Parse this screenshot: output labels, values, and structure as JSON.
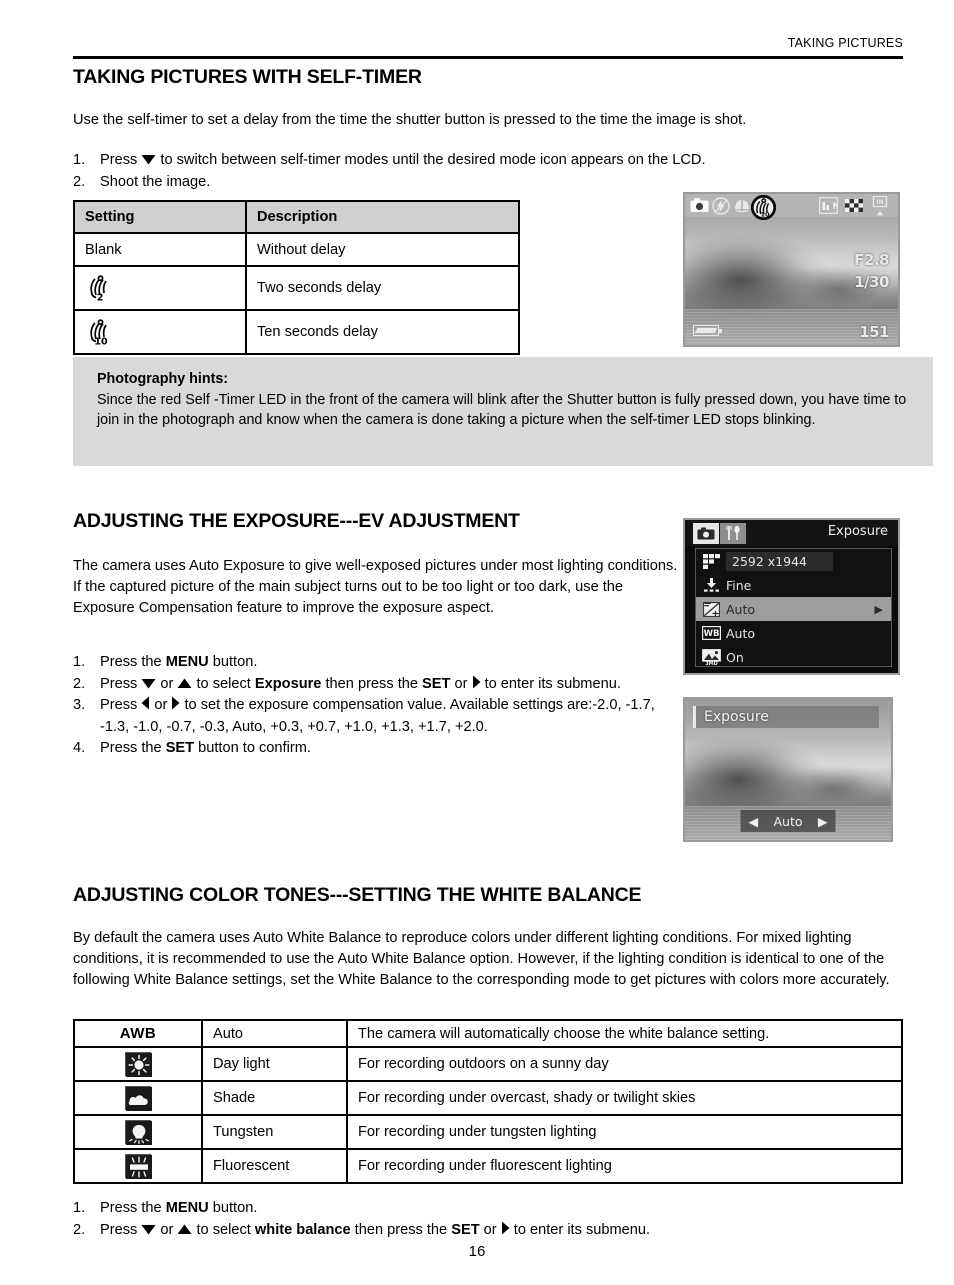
{
  "header": {
    "running_head": "TAKING PICTURES"
  },
  "page_number": "16",
  "sections": {
    "self_timer": {
      "heading": "TAKING PICTURES WITH SELF-TIMER",
      "intro": "Use the self-timer to set a delay from the time the shutter button is pressed to the time the image is shot.",
      "steps": [
        {
          "num": "1.",
          "pre": "Press ",
          "arrow": "down-arrow-icon",
          "post": " to switch between self-timer modes until the desired mode icon appears on the LCD."
        },
        {
          "num": "2.",
          "pre": "Shoot the image.",
          "arrow": "",
          "post": ""
        }
      ],
      "table": {
        "headers": [
          "Setting",
          "Description"
        ],
        "rows": [
          {
            "setting_text": "Blank",
            "setting_icon": "",
            "description": "Without delay"
          },
          {
            "setting_text": "",
            "setting_icon": "self-timer-2s-icon",
            "icon_label": "2",
            "description": "Two seconds delay"
          },
          {
            "setting_text": "",
            "setting_icon": "self-timer-10s-icon",
            "icon_label": "10",
            "description": "Ten seconds delay"
          }
        ]
      },
      "hints": {
        "title": "Photography hints:",
        "body": "Since the red Self -Timer LED in the front of the camera will blink after the Shutter button is fully pressed down, you have time to join in the photograph and know when the camera is done taking a picture when the self-timer LED stops blinking."
      },
      "lcd_screenshot": {
        "name": "camera-lcd-self-timer",
        "osd_icons": [
          "camera-mode-icon",
          "flash-off-icon",
          "macro-icon",
          "self-timer-selected-icon",
          "metering-icon",
          "quality-icon",
          "memory-card-icon"
        ],
        "aperture": "F2.8",
        "shutter_speed": "1/30",
        "shots_remaining": "151"
      }
    },
    "ev_adjustment": {
      "heading": "ADJUSTING THE EXPOSURE---EV ADJUSTMENT",
      "intro": "The camera uses Auto Exposure to give well-exposed pictures under most lighting conditions. If the captured picture of the main subject turns out to be too light or too dark, use the Exposure Compensation feature to improve the exposure aspect.",
      "steps": [
        {
          "num": "1.",
          "html": "Press the <b>MENU</b> button."
        },
        {
          "num": "2.",
          "html": "Press ARROW_DOWN or ARROW_UP to select <b>Exposure</b> then press the <b>SET</b> or ARROW_RIGHT to enter its submenu."
        },
        {
          "num": "3.",
          "html": "Press ARROW_LEFT or ARROW_RIGHT to set the exposure compensation value. Available settings are:-2.0, -1.7, -1.3, -1.0, -0.7, -0.3, Auto, +0.3, +0.7, +1.0, +1.3, +1.7, +2.0."
        },
        {
          "num": "4.",
          "html": "Press the <b>SET</b> button to confirm."
        }
      ],
      "menu_screenshot": {
        "name": "camera-menu-exposure",
        "title": "Exposure",
        "tabs": [
          "capture-tab-icon",
          "setup-tab-icon"
        ],
        "rows": [
          {
            "icon": "resolution-icon",
            "label": "2592 x1944",
            "highlighted": false,
            "boxed": true
          },
          {
            "icon": "quality-icon",
            "label": "Fine",
            "highlighted": false,
            "boxed": false
          },
          {
            "icon": "exposure-icon",
            "label": "Auto",
            "highlighted": true,
            "boxed": false,
            "arrow": "▶"
          },
          {
            "icon": "white-balance-icon",
            "label": "Auto",
            "highlighted": false,
            "boxed": false
          },
          {
            "icon": "scene-icon",
            "label": "On",
            "highlighted": false,
            "boxed": false
          }
        ]
      },
      "preview_screenshot": {
        "name": "camera-exposure-preview",
        "title": "Exposure",
        "left_arrow": "◀",
        "value": "Auto",
        "right_arrow": "▶"
      }
    },
    "white_balance": {
      "heading": "ADJUSTING COLOR TONES---SETTING THE WHITE BALANCE",
      "intro": "By default the camera uses Auto White Balance to reproduce colors under different lighting conditions. For mixed lighting conditions, it is recommended to use the Auto White Balance option. However, if the lighting condition is identical to one of the following White Balance settings, set the White Balance to the corresponding mode to get pictures with colors more accurately.",
      "table": {
        "rows": [
          {
            "icon": "awb-text-icon",
            "icon_text": "AWB",
            "mode": "Auto",
            "description": "The camera will automatically choose the white balance setting."
          },
          {
            "icon": "sun-icon",
            "icon_text": "",
            "mode": "Day light",
            "description": "For recording outdoors on a sunny day"
          },
          {
            "icon": "cloud-icon",
            "icon_text": "",
            "mode": "Shade",
            "description": "For recording under overcast, shady or twilight skies"
          },
          {
            "icon": "tungsten-bulb-icon",
            "icon_text": "",
            "mode": "Tungsten",
            "description": "For recording under tungsten lighting"
          },
          {
            "icon": "fluorescent-tube-icon",
            "icon_text": "",
            "mode": "Fluorescent",
            "description": "For recording under fluorescent lighting"
          }
        ]
      },
      "steps": [
        {
          "num": "1.",
          "html": "Press the <b>MENU</b> button."
        },
        {
          "num": "2.",
          "html": "Press ARROW_DOWN or ARROW_UP to select <b>white balance</b> then press the <b>SET</b> or ARROW_RIGHT to enter its submenu."
        }
      ]
    }
  },
  "colors": {
    "header_rule": "#000000",
    "table_header_fill": "#d0d0d0",
    "hint_box_fill": "#d9d9d9",
    "menu_highlight": "#9d9d9d"
  }
}
